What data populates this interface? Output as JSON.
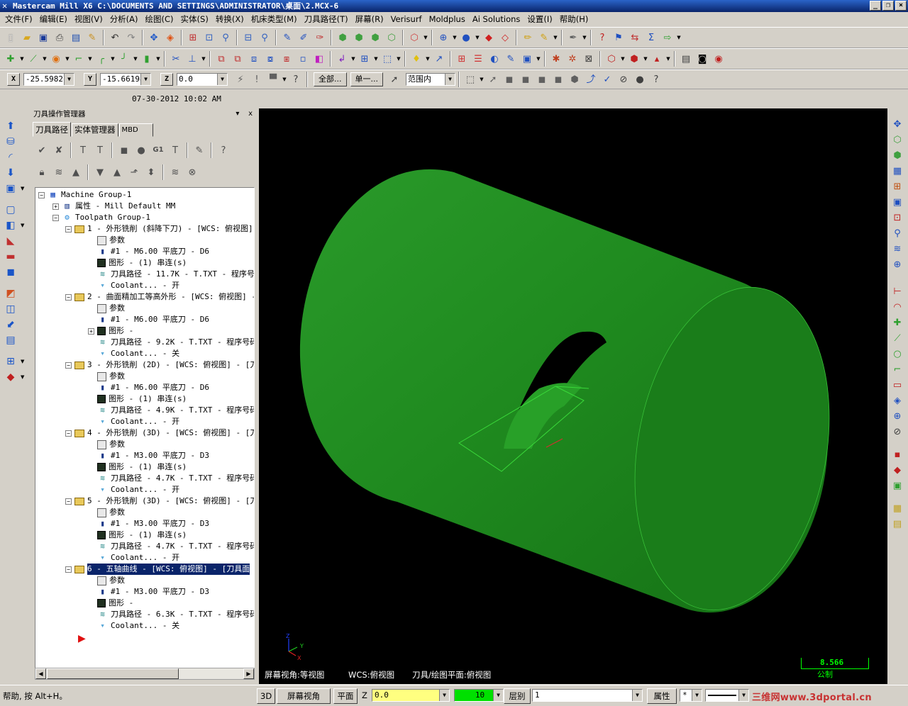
{
  "window": {
    "title": "Mastercam Mill X6  C:\\DOCUMENTS AND SETTINGS\\ADMINISTRATOR\\桌面\\2.MCX-6",
    "minimize": "_",
    "restore": "❐",
    "close": "×"
  },
  "menu": [
    "文件(F)",
    "编辑(E)",
    "视图(V)",
    "分析(A)",
    "绘图(C)",
    "实体(S)",
    "转换(X)",
    "机床类型(M)",
    "刀具路径(T)",
    "屏幕(R)",
    "Verisurf",
    "Moldplus",
    "Ai Solutions",
    "设置(I)",
    "帮助(H)"
  ],
  "coords": {
    "x_label": "X",
    "x_value": "-25.5982",
    "y_label": "Y",
    "y_value": "-15.66198",
    "z_label": "Z",
    "z_value": "0.0",
    "btn_all": "全部...",
    "btn_single": "单一...",
    "range_value": "范围内"
  },
  "timestamp": "07-30-2012 10:02 AM",
  "ops_manager": {
    "title": "刀具操作管理器",
    "pin": "▾",
    "close": "x",
    "tabs": [
      "刀具路径",
      "实体管理器",
      "MBD"
    ],
    "tree": [
      {
        "text": "Machine Group-1",
        "indent": 0,
        "expand": "−",
        "icon": "machine"
      },
      {
        "text": "属性 - Mill Default MM",
        "indent": 1,
        "expand": "+",
        "icon": "props"
      },
      {
        "text": "Toolpath Group-1",
        "indent": 1,
        "expand": "−",
        "icon": "group"
      },
      {
        "text": "1 - 外形铣削 (斜降下刀) - [WCS: 俯视图] - [刀具面",
        "indent": 2,
        "expand": "−",
        "icon": "folder"
      },
      {
        "text": "参数",
        "indent": 3,
        "icon": "params"
      },
      {
        "text": "#1 - M6.00 平底刀 - D6",
        "indent": 3,
        "icon": "tool"
      },
      {
        "text": "图形 - (1) 串连(s)",
        "indent": 3,
        "icon": "geom"
      },
      {
        "text": "刀具路径 - 11.7K - T.TXT - 程序号码",
        "indent": 3,
        "icon": "path"
      },
      {
        "text": "Coolant... - 开",
        "indent": 3,
        "icon": "cool"
      },
      {
        "text": "2 - 曲面精加工等高外形 - [WCS: 俯视图] - [刀具面",
        "indent": 2,
        "expand": "−",
        "icon": "folder"
      },
      {
        "text": "参数",
        "indent": 3,
        "icon": "params"
      },
      {
        "text": "#1 - M6.00 平底刀 - D6",
        "indent": 3,
        "icon": "tool"
      },
      {
        "text": "图形 -",
        "indent": 3,
        "icon": "geom",
        "expand": "+"
      },
      {
        "text": "刀具路径 - 9.2K - T.TXT - 程序号码",
        "indent": 3,
        "icon": "path"
      },
      {
        "text": "Coolant... - 关",
        "indent": 3,
        "icon": "cool"
      },
      {
        "text": "3 - 外形铣削 (2D) - [WCS: 俯视图] - [刀具面",
        "indent": 2,
        "expand": "−",
        "icon": "folder"
      },
      {
        "text": "参数",
        "indent": 3,
        "icon": "params"
      },
      {
        "text": "#1 - M6.00 平底刀 - D6",
        "indent": 3,
        "icon": "tool"
      },
      {
        "text": "图形 - (1) 串连(s)",
        "indent": 3,
        "icon": "geom"
      },
      {
        "text": "刀具路径 - 4.9K - T.TXT - 程序号码",
        "indent": 3,
        "icon": "path"
      },
      {
        "text": "Coolant... - 开",
        "indent": 3,
        "icon": "cool"
      },
      {
        "text": "4 - 外形铣削 (3D) - [WCS: 俯视图] - [刀具面",
        "indent": 2,
        "expand": "−",
        "icon": "folder"
      },
      {
        "text": "参数",
        "indent": 3,
        "icon": "params"
      },
      {
        "text": "#1 - M3.00 平底刀 - D3",
        "indent": 3,
        "icon": "tool"
      },
      {
        "text": "图形 - (1) 串连(s)",
        "indent": 3,
        "icon": "geom"
      },
      {
        "text": "刀具路径 - 4.7K - T.TXT - 程序号码",
        "indent": 3,
        "icon": "path"
      },
      {
        "text": "Coolant... - 开",
        "indent": 3,
        "icon": "cool"
      },
      {
        "text": "5 - 外形铣削 (3D) - [WCS: 俯视图] - [刀具面",
        "indent": 2,
        "expand": "−",
        "icon": "folder"
      },
      {
        "text": "参数",
        "indent": 3,
        "icon": "params"
      },
      {
        "text": "#1 - M3.00 平底刀 - D3",
        "indent": 3,
        "icon": "tool"
      },
      {
        "text": "图形 - (1) 串连(s)",
        "indent": 3,
        "icon": "geom"
      },
      {
        "text": "刀具路径 - 4.7K - T.TXT - 程序号码",
        "indent": 3,
        "icon": "path"
      },
      {
        "text": "Coolant... - 开",
        "indent": 3,
        "icon": "cool"
      },
      {
        "text": "6 - 五轴曲线 - [WCS: 俯视图] - [刀具面",
        "indent": 2,
        "expand": "−",
        "icon": "folder",
        "selected": true
      },
      {
        "text": "参数",
        "indent": 3,
        "icon": "params"
      },
      {
        "text": "#1 - M3.00 平底刀 - D3",
        "indent": 3,
        "icon": "tool"
      },
      {
        "text": "图形 -",
        "indent": 3,
        "icon": "geom"
      },
      {
        "text": "刀具路径 - 6.3K - T.TXT - 程序号码",
        "indent": 3,
        "icon": "path"
      },
      {
        "text": "Coolant... - 关",
        "indent": 3,
        "icon": "cool"
      }
    ]
  },
  "viewport": {
    "background": "#000000",
    "part_color": "#1f8a1f",
    "status_view": "屏幕视角:等视图",
    "status_wcs": "WCS:俯视图",
    "status_plane": "刀具/绘图平面:俯视图",
    "scale_value": "8.566",
    "scale_unit": "公制",
    "axis_x": "X",
    "axis_y": "Y",
    "axis_z": "Z"
  },
  "statusbar": {
    "help": "帮助, 按 Alt+H。",
    "btn_3d": "3D",
    "btn_view": "屏幕视角",
    "btn_plane": "平面",
    "z_label": "Z",
    "z_value": "0.0",
    "color_value": "10",
    "level_label": "层别",
    "level_value": "1",
    "attr_label": "属性",
    "line_style": "*",
    "watermark": "三维网www.3dportal.cn"
  }
}
